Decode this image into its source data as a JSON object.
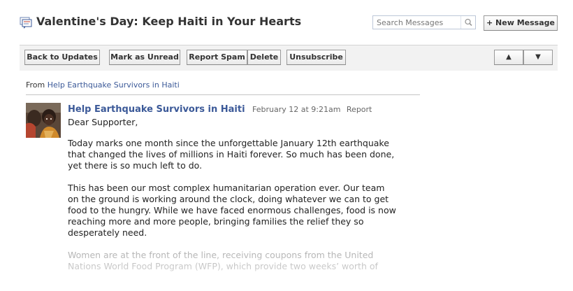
{
  "header": {
    "title": "Valentine's Day: Keep Haiti in Your Hearts",
    "title_icon": "messages-icon",
    "search_placeholder": "Search Messages",
    "new_message_label": "+ New Message"
  },
  "toolbar": {
    "back_label": "Back to Updates",
    "mark_unread_label": "Mark as Unread",
    "report_spam_label": "Report Spam",
    "delete_label": "Delete",
    "unsubscribe_label": "Unsubscribe",
    "prev_label": "▲",
    "next_label": "▼"
  },
  "thread": {
    "from_prefix": "From",
    "from_name": "Help Earthquake Survivors in Haiti"
  },
  "message": {
    "sender": "Help Earthquake Survivors in Haiti",
    "timestamp": "February 12 at 9:21am",
    "report_label": "Report",
    "paragraphs": [
      "Dear Supporter,",
      "Today marks one month since the unforgettable January 12th earthquake that changed the lives of millions in Haiti forever. So much has been done, yet there is so much left to do.",
      "This has been our most complex humanitarian operation ever. Our team on the ground is working around the clock, doing whatever we can to get food to the hungry. While we have faced enormous challenges, food is now reaching more and more people, bringing families the relief they so desperately need.",
      "Women are at the front of the line, receiving coupons from the United Nations World Food Program (WFP), which provide two weeks’ worth of"
    ]
  },
  "colors": {
    "link": "#3b5998",
    "toolbar_bg": "#f2f2f2",
    "button_border": "#999999"
  }
}
